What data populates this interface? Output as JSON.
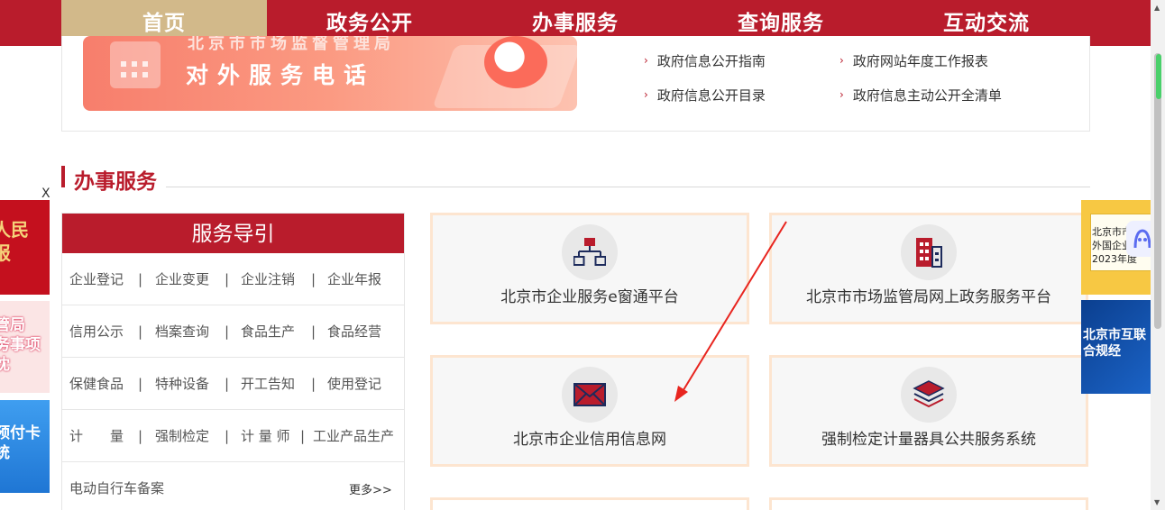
{
  "nav": {
    "items": [
      {
        "label": "首页",
        "active": true
      },
      {
        "label": "政务公开",
        "active": false
      },
      {
        "label": "办事服务",
        "active": false
      },
      {
        "label": "查询服务",
        "active": false
      },
      {
        "label": "互动交流",
        "active": false
      }
    ]
  },
  "banner": {
    "subtitle": "北京市市场监督管理局",
    "title": "对外服务电话"
  },
  "info_links": [
    "政府信息公开指南",
    "政府网站年度工作报表",
    "政府信息公开目录",
    "政府信息主动公开全清单"
  ],
  "section": {
    "title": "办事服务"
  },
  "guide": {
    "title": "服务导引",
    "rows": [
      [
        "企业登记",
        "企业变更",
        "企业注销",
        "企业年报"
      ],
      [
        "信用公示",
        "档案查询",
        "食品生产",
        "食品经营"
      ],
      [
        "保健食品",
        "特种设备",
        "开工告知",
        "使用登记"
      ],
      [
        "计　　量",
        "强制检定",
        "计 量 师",
        "工业产品生产"
      ]
    ],
    "last_item": "电动自行车备案",
    "more": "更多>>",
    "separator": "|"
  },
  "cards": [
    {
      "label": "北京市企业服务e窗通平台",
      "icon": "org-chart-icon"
    },
    {
      "label": "北京市市场监管局网上政务服务平台",
      "icon": "building-icon"
    },
    {
      "label": "北京市企业信用信息网",
      "icon": "envelope-icon"
    },
    {
      "label": "强制检定计量器具公共服务系统",
      "icon": "layers-icon"
    }
  ],
  "float_ads": {
    "close": "X",
    "left": [
      "人民\n报",
      "管局\n务事项\n沈",
      "预付卡\n统"
    ],
    "right": [
      "北京市市\n外国企业\n2023年度",
      "北京市互联\n合规经"
    ]
  },
  "colors": {
    "brand_red": "#b91c2c",
    "nav_active": "#d2b98a",
    "card_border": "#fde5d0"
  }
}
